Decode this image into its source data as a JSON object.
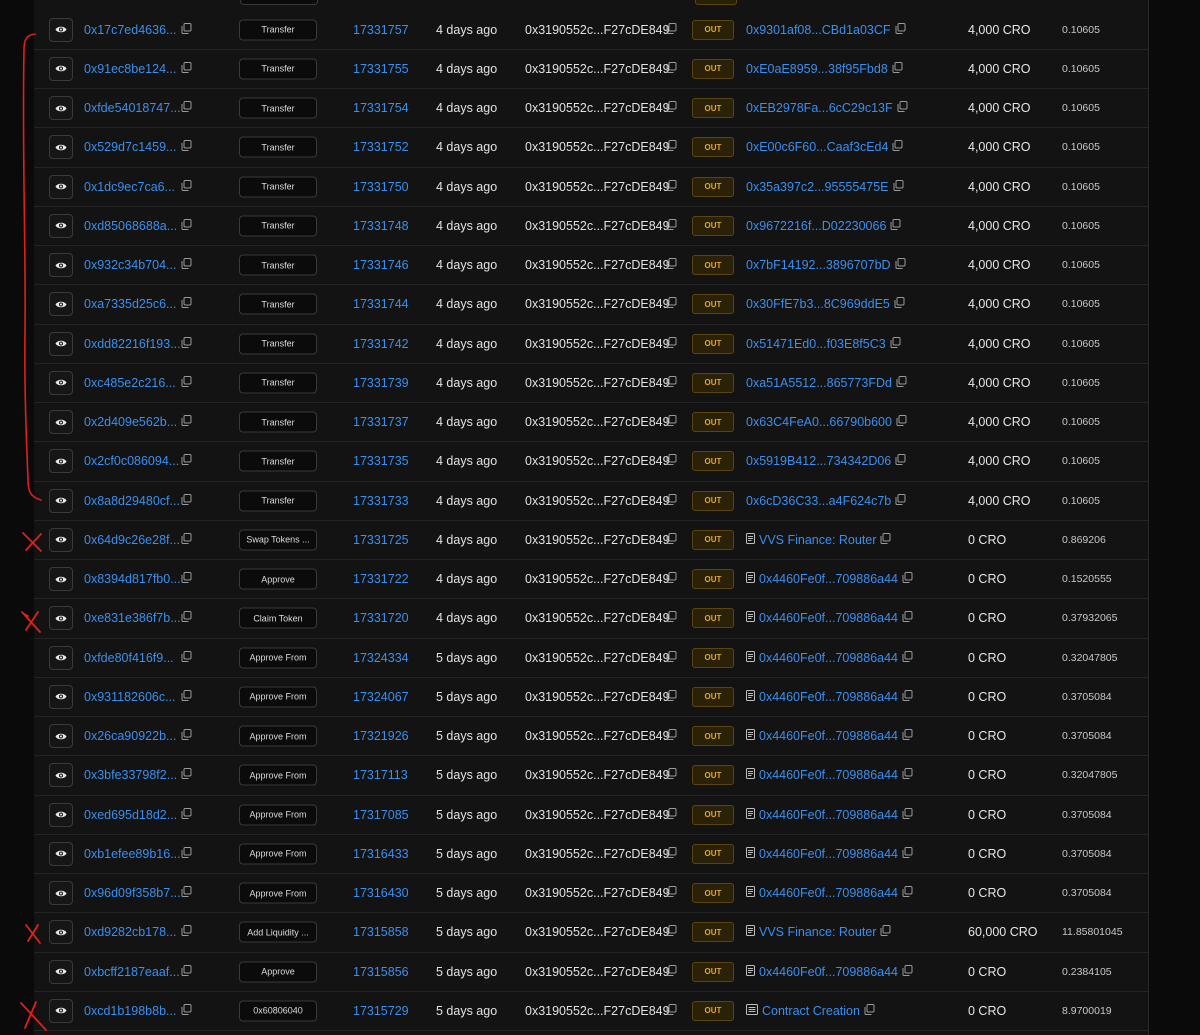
{
  "rows": [
    {
      "hash": "0x17c7ed4636...",
      "method": "Transfer",
      "block": "17331757",
      "age": "4 days ago",
      "from": "0x3190552c...F27cDE849",
      "dir": "OUT",
      "to": "0x9301af08...CBd1a03CF",
      "to_type": "address",
      "value": "4,000 CRO",
      "fee": "0.10605"
    },
    {
      "hash": "0x91ec8be124...",
      "method": "Transfer",
      "block": "17331755",
      "age": "4 days ago",
      "from": "0x3190552c...F27cDE849",
      "dir": "OUT",
      "to": "0xE0aE8959...38f95Fbd8",
      "to_type": "address",
      "value": "4,000 CRO",
      "fee": "0.10605"
    },
    {
      "hash": "0xfde54018747...",
      "method": "Transfer",
      "block": "17331754",
      "age": "4 days ago",
      "from": "0x3190552c...F27cDE849",
      "dir": "OUT",
      "to": "0xEB2978Fa...6cC29c13F",
      "to_type": "address",
      "value": "4,000 CRO",
      "fee": "0.10605"
    },
    {
      "hash": "0x529d7c1459...",
      "method": "Transfer",
      "block": "17331752",
      "age": "4 days ago",
      "from": "0x3190552c...F27cDE849",
      "dir": "OUT",
      "to": "0xE00c6F60...Caaf3cEd4",
      "to_type": "address",
      "value": "4,000 CRO",
      "fee": "0.10605"
    },
    {
      "hash": "0x1dc9ec7ca6...",
      "method": "Transfer",
      "block": "17331750",
      "age": "4 days ago",
      "from": "0x3190552c...F27cDE849",
      "dir": "OUT",
      "to": "0x35a397c2...95555475E",
      "to_type": "address",
      "value": "4,000 CRO",
      "fee": "0.10605"
    },
    {
      "hash": "0xd85068688a...",
      "method": "Transfer",
      "block": "17331748",
      "age": "4 days ago",
      "from": "0x3190552c...F27cDE849",
      "dir": "OUT",
      "to": "0x9672216f...D02230066",
      "to_type": "address",
      "value": "4,000 CRO",
      "fee": "0.10605"
    },
    {
      "hash": "0x932c34b704...",
      "method": "Transfer",
      "block": "17331746",
      "age": "4 days ago",
      "from": "0x3190552c...F27cDE849",
      "dir": "OUT",
      "to": "0x7bF14192...3896707bD",
      "to_type": "address",
      "value": "4,000 CRO",
      "fee": "0.10605"
    },
    {
      "hash": "0xa7335d25c6...",
      "method": "Transfer",
      "block": "17331744",
      "age": "4 days ago",
      "from": "0x3190552c...F27cDE849",
      "dir": "OUT",
      "to": "0x30FfE7b3...8C969ddE5",
      "to_type": "address",
      "value": "4,000 CRO",
      "fee": "0.10605"
    },
    {
      "hash": "0xdd82216f193...",
      "method": "Transfer",
      "block": "17331742",
      "age": "4 days ago",
      "from": "0x3190552c...F27cDE849",
      "dir": "OUT",
      "to": "0x51471Ed0...f03E8f5C3",
      "to_type": "address",
      "value": "4,000 CRO",
      "fee": "0.10605"
    },
    {
      "hash": "0xc485e2c216...",
      "method": "Transfer",
      "block": "17331739",
      "age": "4 days ago",
      "from": "0x3190552c...F27cDE849",
      "dir": "OUT",
      "to": "0xa51A5512...865773FDd",
      "to_type": "address",
      "value": "4,000 CRO",
      "fee": "0.10605"
    },
    {
      "hash": "0x2d409e562b...",
      "method": "Transfer",
      "block": "17331737",
      "age": "4 days ago",
      "from": "0x3190552c...F27cDE849",
      "dir": "OUT",
      "to": "0x63C4FeA0...66790b600",
      "to_type": "address",
      "value": "4,000 CRO",
      "fee": "0.10605"
    },
    {
      "hash": "0x2cf0c086094...",
      "method": "Transfer",
      "block": "17331735",
      "age": "4 days ago",
      "from": "0x3190552c...F27cDE849",
      "dir": "OUT",
      "to": "0x5919B412...734342D06",
      "to_type": "address",
      "value": "4,000 CRO",
      "fee": "0.10605"
    },
    {
      "hash": "0x8a8d29480cf...",
      "method": "Transfer",
      "block": "17331733",
      "age": "4 days ago",
      "from": "0x3190552c...F27cDE849",
      "dir": "OUT",
      "to": "0x6cD36C33...a4F624c7b",
      "to_type": "address",
      "value": "4,000 CRO",
      "fee": "0.10605"
    },
    {
      "hash": "0x64d9c26e28f...",
      "method": "Swap Tokens ...",
      "block": "17331725",
      "age": "4 days ago",
      "from": "0x3190552c...F27cDE849",
      "dir": "OUT",
      "to": "VVS Finance: Router",
      "to_type": "contract",
      "value": "0 CRO",
      "fee": "0.869206"
    },
    {
      "hash": "0x8394d817fb0...",
      "method": "Approve",
      "block": "17331722",
      "age": "4 days ago",
      "from": "0x3190552c...F27cDE849",
      "dir": "OUT",
      "to": "0x4460Fe0f...709886a44",
      "to_type": "contract",
      "value": "0 CRO",
      "fee": "0.1520555"
    },
    {
      "hash": "0xe831e386f7b...",
      "method": "Claim Token",
      "block": "17331720",
      "age": "4 days ago",
      "from": "0x3190552c...F27cDE849",
      "dir": "OUT",
      "to": "0x4460Fe0f...709886a44",
      "to_type": "contract",
      "value": "0 CRO",
      "fee": "0.37932065"
    },
    {
      "hash": "0xfde80f416f9...",
      "method": "Approve From",
      "block": "17324334",
      "age": "5 days ago",
      "from": "0x3190552c...F27cDE849",
      "dir": "OUT",
      "to": "0x4460Fe0f...709886a44",
      "to_type": "contract",
      "value": "0 CRO",
      "fee": "0.32047805"
    },
    {
      "hash": "0x931182606c...",
      "method": "Approve From",
      "block": "17324067",
      "age": "5 days ago",
      "from": "0x3190552c...F27cDE849",
      "dir": "OUT",
      "to": "0x4460Fe0f...709886a44",
      "to_type": "contract",
      "value": "0 CRO",
      "fee": "0.3705084"
    },
    {
      "hash": "0x26ca90922b...",
      "method": "Approve From",
      "block": "17321926",
      "age": "5 days ago",
      "from": "0x3190552c...F27cDE849",
      "dir": "OUT",
      "to": "0x4460Fe0f...709886a44",
      "to_type": "contract",
      "value": "0 CRO",
      "fee": "0.3705084"
    },
    {
      "hash": "0x3bfe33798f2...",
      "method": "Approve From",
      "block": "17317113",
      "age": "5 days ago",
      "from": "0x3190552c...F27cDE849",
      "dir": "OUT",
      "to": "0x4460Fe0f...709886a44",
      "to_type": "contract",
      "value": "0 CRO",
      "fee": "0.32047805"
    },
    {
      "hash": "0xed695d18d2...",
      "method": "Approve From",
      "block": "17317085",
      "age": "5 days ago",
      "from": "0x3190552c...F27cDE849",
      "dir": "OUT",
      "to": "0x4460Fe0f...709886a44",
      "to_type": "contract",
      "value": "0 CRO",
      "fee": "0.3705084"
    },
    {
      "hash": "0xb1efee89b16...",
      "method": "Approve From",
      "block": "17316433",
      "age": "5 days ago",
      "from": "0x3190552c...F27cDE849",
      "dir": "OUT",
      "to": "0x4460Fe0f...709886a44",
      "to_type": "contract",
      "value": "0 CRO",
      "fee": "0.3705084"
    },
    {
      "hash": "0x96d09f358b7...",
      "method": "Approve From",
      "block": "17316430",
      "age": "5 days ago",
      "from": "0x3190552c...F27cDE849",
      "dir": "OUT",
      "to": "0x4460Fe0f...709886a44",
      "to_type": "contract",
      "value": "0 CRO",
      "fee": "0.3705084"
    },
    {
      "hash": "0xd9282cb178...",
      "method": "Add Liquidity ...",
      "block": "17315858",
      "age": "5 days ago",
      "from": "0x3190552c...F27cDE849",
      "dir": "OUT",
      "to": "VVS Finance: Router",
      "to_type": "contract",
      "value": "60,000 CRO",
      "fee": "11.85801045"
    },
    {
      "hash": "0xbcff2187eaaf...",
      "method": "Approve",
      "block": "17315856",
      "age": "5 days ago",
      "from": "0x3190552c...F27cDE849",
      "dir": "OUT",
      "to": "0x4460Fe0f...709886a44",
      "to_type": "contract",
      "value": "0 CRO",
      "fee": "0.2384105"
    },
    {
      "hash": "0xcd1b198b8b...",
      "method": "0x60806040",
      "block": "17315729",
      "age": "5 days ago",
      "from": "0x3190552c...F27cDE849",
      "dir": "OUT",
      "to": "Contract Creation",
      "to_type": "creation",
      "value": "0 CRO",
      "fee": "8.9700019"
    }
  ],
  "icons": {
    "view": "eye-icon",
    "copy": "copy-icon",
    "contract": "contract-doc-icon",
    "creation": "contract-creation-icon"
  },
  "colors": {
    "link": "#3b8ff0",
    "out_badge_text": "#e0a92c",
    "out_badge_bg": "#2b2107",
    "annotation_red": "#e0201b"
  }
}
